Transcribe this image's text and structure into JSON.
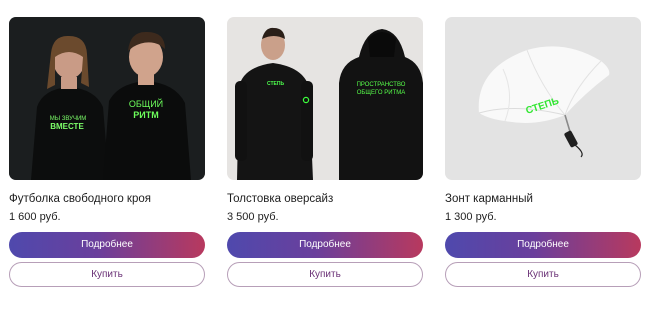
{
  "products": [
    {
      "title": "Футболка свободного кроя",
      "price": "1 600 руб.",
      "details_label": "Подробнее",
      "buy_label": "Купить",
      "print_left": [
        "МЫ ЗВУЧИМ",
        "ВМЕСТЕ"
      ],
      "print_right": [
        "ОБЩИЙ",
        "РИТМ"
      ]
    },
    {
      "title": "Толстовка оверсайз",
      "price": "3 500 руб.",
      "details_label": "Подробнее",
      "buy_label": "Купить",
      "print_logo": "СТЕПЬ",
      "print_back": [
        "ПРОСТРАНСТВО",
        "ОБЩЕГО РИТМА"
      ]
    },
    {
      "title": "Зонт карманный",
      "price": "1 300 руб.",
      "details_label": "Подробнее",
      "buy_label": "Купить",
      "print_logo": "СТЕПЬ"
    }
  ],
  "colors": {
    "print_green": "#3dff3d",
    "button_gradient_start": "#4f49ad",
    "button_gradient_end": "#b8395e",
    "buy_text": "#6a3176"
  }
}
